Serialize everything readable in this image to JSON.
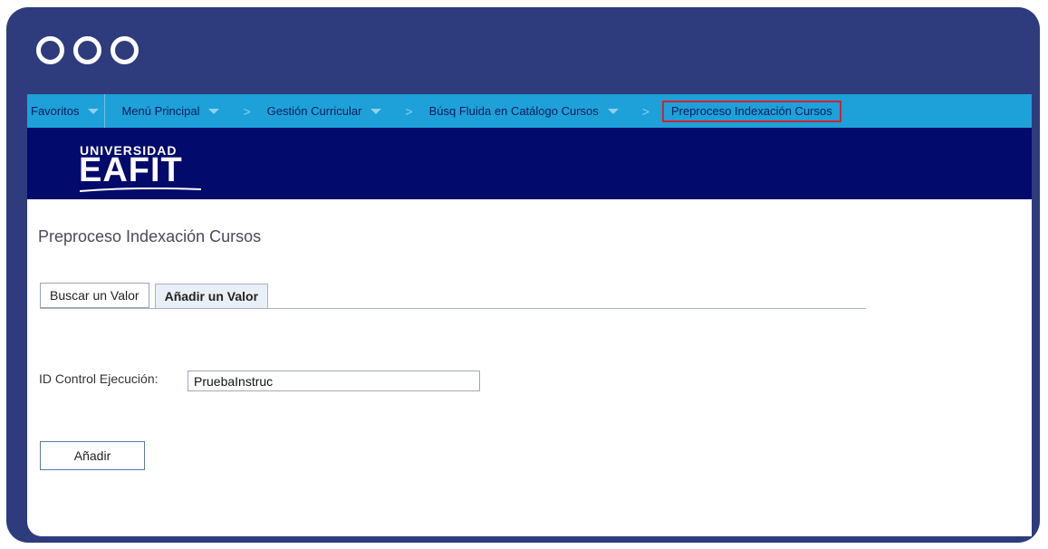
{
  "window": {
    "controls": [
      "circle",
      "circle",
      "circle"
    ],
    "frame_color": "#2e3c7e"
  },
  "navbar": {
    "color": "#1da1d8",
    "items": [
      {
        "label": "Favoritos"
      },
      {
        "label": "Menú Principal"
      },
      {
        "label": "Gestión Curricular"
      },
      {
        "label": "Búsq Fluida en Catálogo Cursos"
      },
      {
        "label": "Preproceso Indexación Cursos"
      }
    ]
  },
  "header": {
    "color": "#020a6c",
    "logo_small": "UNIVERSIDAD",
    "logo_big": "EAFIT"
  },
  "page": {
    "title": "Preproceso Indexación Cursos",
    "tabs": [
      {
        "label": "Buscar un Valor",
        "active": false
      },
      {
        "label": "Añadir un Valor",
        "active": true
      }
    ],
    "field": {
      "label": "ID Control Ejecución:",
      "value": "PruebaInstruc"
    },
    "add_button": "Añadir"
  }
}
